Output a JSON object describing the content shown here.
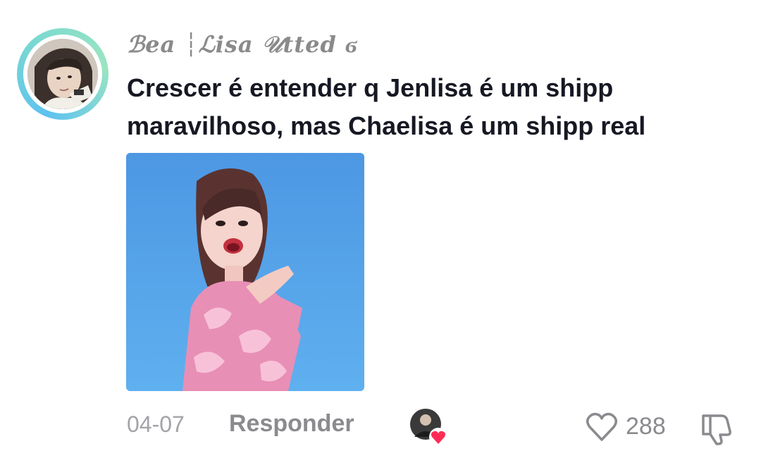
{
  "comment": {
    "username": "ℬea ┆ℒisa 𝒰tted ϭ",
    "text": "Crescer é entender q Jenlisa é um shipp maravilhoso, mas Chaelisa é um shipp real",
    "date": "04-07",
    "reply_label": "Responder",
    "like_count": "288",
    "icons": {
      "avatar": "profile-avatar",
      "liker": "creator-liked-avatar-heart",
      "like": "heart-outline-icon",
      "dislike": "thumbs-down-icon"
    },
    "colors": {
      "ring_start": "#5ec2f0",
      "ring_end": "#9be5c0",
      "text": "#161823",
      "muted": "#8a8a8f",
      "heart": "#fe2c55"
    }
  }
}
